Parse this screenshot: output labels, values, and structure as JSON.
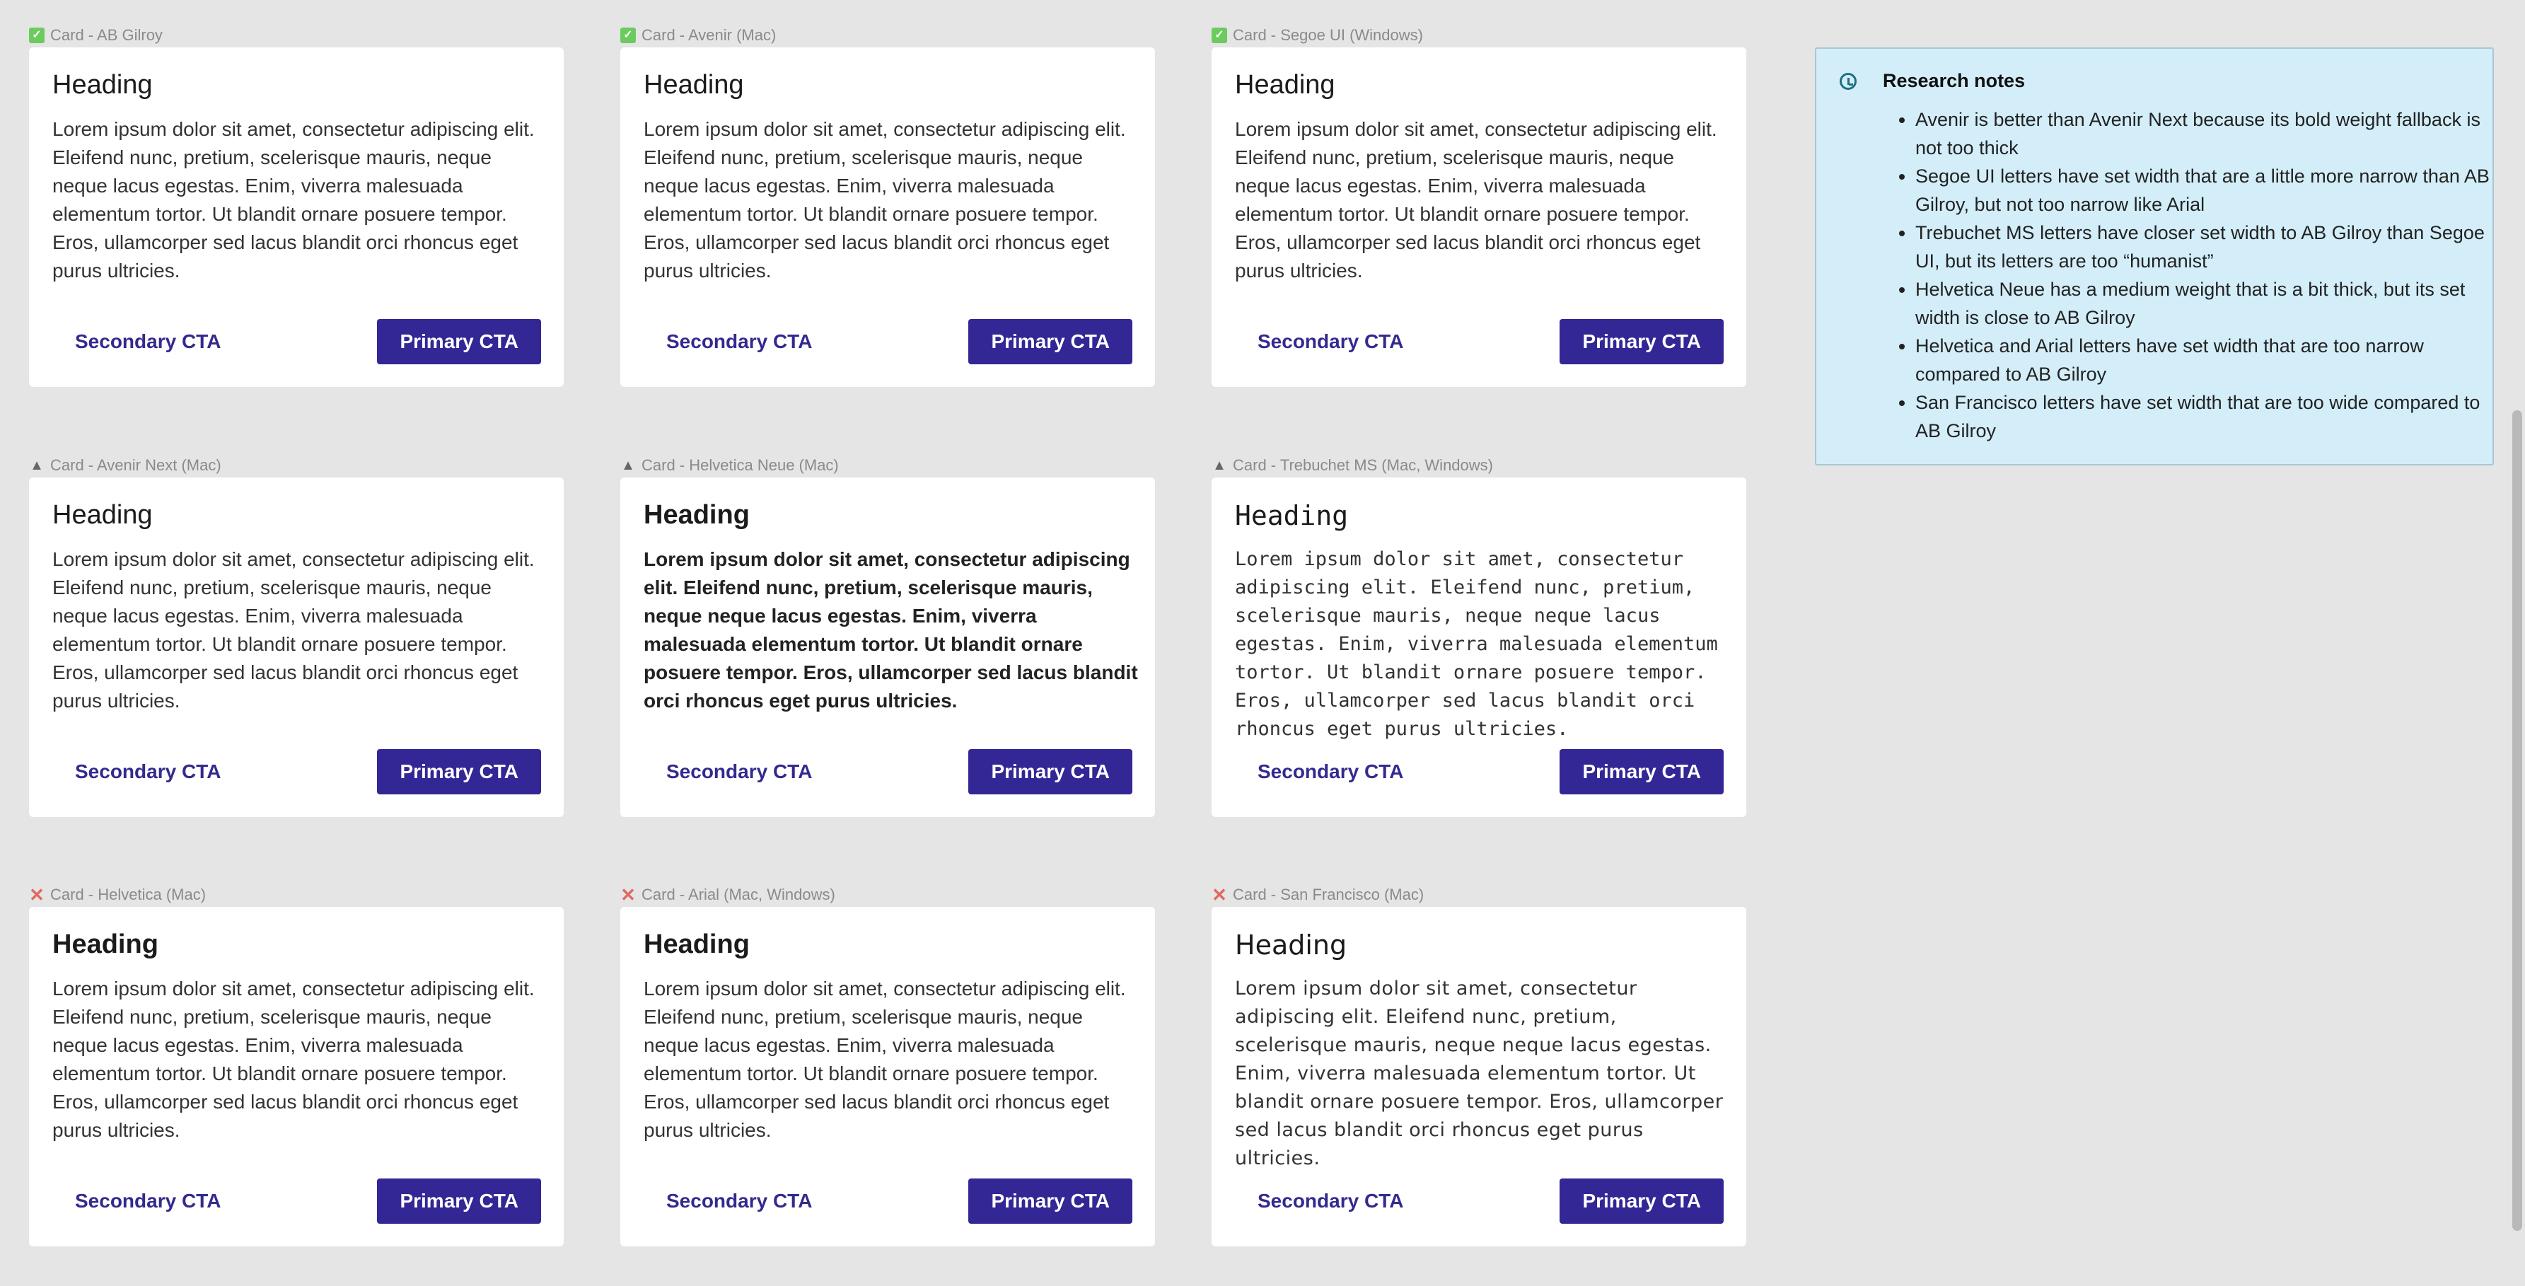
{
  "cards": [
    {
      "label": "Card - AB Gilroy",
      "status": "check"
    },
    {
      "label": "Card - Avenir (Mac)",
      "status": "check"
    },
    {
      "label": "Card - Segoe UI (Windows)",
      "status": "check"
    },
    {
      "label": "Card - Avenir Next (Mac)",
      "status": "warning"
    },
    {
      "label": "Card - Helvetica Neue (Mac)",
      "status": "warning"
    },
    {
      "label": "Card - Trebuchet MS (Mac, Windows)",
      "status": "warning"
    },
    {
      "label": "Card - Helvetica (Mac)",
      "status": "cross"
    },
    {
      "label": "Card - Arial (Mac, Windows)",
      "status": "cross"
    },
    {
      "label": "Card - San Francisco (Mac)",
      "status": "cross"
    }
  ],
  "card_content": {
    "heading": "Heading",
    "body": "Lorem ipsum dolor sit amet, consectetur adipiscing elit. Eleifend nunc, pretium, scelerisque mauris, neque neque lacus egestas. Enim, viverra malesuada elementum tortor. Ut blandit ornare posuere tempor. Eros, ullamcorper sed lacus blandit orci rhoncus eget purus ultricies.",
    "secondary_cta": "Secondary CTA",
    "primary_cta": "Primary CTA"
  },
  "status_icons": {
    "check": "✓",
    "warning": "▲",
    "cross": "✕"
  },
  "colors": {
    "primary": "#322794",
    "secondary_text": "#332a8f",
    "notes_bg": "#d3eef9"
  },
  "notes": {
    "title": "Research notes",
    "items": [
      "Avenir is better than Avenir Next because its bold weight fallback is not too thick",
      "Segoe UI letters have set width that are a little more narrow than AB Gilroy, but not too narrow like Arial",
      "Trebuchet MS letters have closer set width to AB Gilroy than Segoe UI, but its letters are too “humanist”",
      "Helvetica Neue has a medium weight that is a bit thick, but its set width is close to AB Gilroy",
      "Helvetica and Arial letters have set width that are too narrow compared to AB Gilroy",
      "San Francisco letters have set width that are too wide compared to AB Gilroy"
    ]
  }
}
